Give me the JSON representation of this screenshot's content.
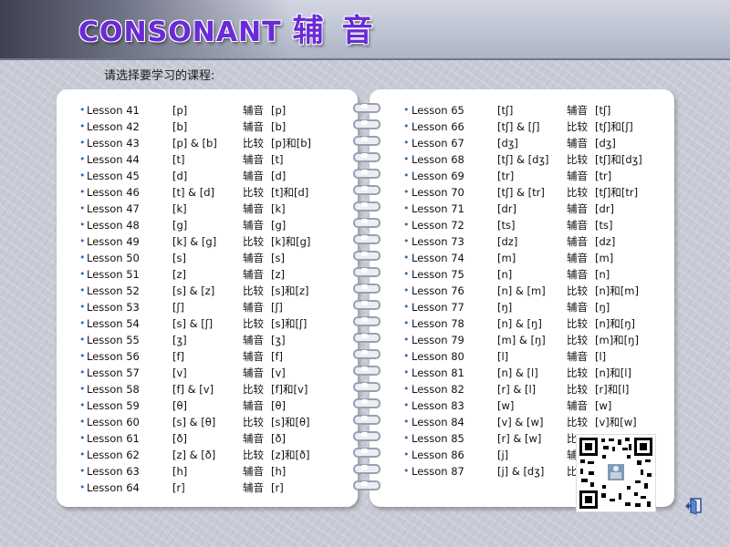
{
  "header": {
    "title_en": "CONSONANT",
    "title_cn": "辅 音"
  },
  "prompt": "请选择要学习的课程:",
  "colors": {
    "title": "#6a2ad8",
    "bullet": "#2f70b5",
    "page": "#ffffff",
    "background": "#c9ccd6"
  },
  "left_page": {
    "lessons": [
      {
        "name": "Lesson 41",
        "symbol": "[p]",
        "kind": "辅音",
        "desc": "[p]"
      },
      {
        "name": "Lesson 42",
        "symbol": "[b]",
        "kind": "辅音",
        "desc": "[b]"
      },
      {
        "name": "Lesson 43",
        "symbol": "[p] & [b]",
        "kind": "比较",
        "desc": "[p]和[b]"
      },
      {
        "name": "Lesson 44",
        "symbol": "[t]",
        "kind": "辅音",
        "desc": "[t]"
      },
      {
        "name": "Lesson 45",
        "symbol": "[d]",
        "kind": "辅音",
        "desc": "[d]"
      },
      {
        "name": "Lesson 46",
        "symbol": "[t] & [d]",
        "kind": "比较",
        "desc": "[t]和[d]"
      },
      {
        "name": "Lesson 47",
        "symbol": "[k]",
        "kind": "辅音",
        "desc": "[k]"
      },
      {
        "name": "Lesson 48",
        "symbol": "[g]",
        "kind": "辅音",
        "desc": "[g]"
      },
      {
        "name": "Lesson 49",
        "symbol": "[k] & [g]",
        "kind": "比较",
        "desc": "[k]和[g]"
      },
      {
        "name": "Lesson 50",
        "symbol": "[s]",
        "kind": "辅音",
        "desc": "[s]"
      },
      {
        "name": "Lesson 51",
        "symbol": "[z]",
        "kind": "辅音",
        "desc": "[z]"
      },
      {
        "name": "Lesson 52",
        "symbol": "[s] & [z]",
        "kind": "比较",
        "desc": "[s]和[z]"
      },
      {
        "name": "Lesson 53",
        "symbol": "[ʃ]",
        "kind": "辅音",
        "desc": "[ʃ]"
      },
      {
        "name": "Lesson 54",
        "symbol": "[s] & [ʃ]",
        "kind": "比较",
        "desc": "[s]和[ʃ]"
      },
      {
        "name": "Lesson 55",
        "symbol": "[ʒ]",
        "kind": "辅音",
        "desc": "[ʒ]"
      },
      {
        "name": "Lesson 56",
        "symbol": "[f]",
        "kind": "辅音",
        "desc": "[f]"
      },
      {
        "name": "Lesson 57",
        "symbol": "[v]",
        "kind": "辅音",
        "desc": "[v]"
      },
      {
        "name": "Lesson 58",
        "symbol": "[f] & [v]",
        "kind": "比较",
        "desc": "[f]和[v]"
      },
      {
        "name": "Lesson 59",
        "symbol": "[θ]",
        "kind": "辅音",
        "desc": "[θ]"
      },
      {
        "name": "Lesson 60",
        "symbol": "[s] & [θ]",
        "kind": "比较",
        "desc": "[s]和[θ]"
      },
      {
        "name": "Lesson 61",
        "symbol": "[ð]",
        "kind": "辅音",
        "desc": "[ð]"
      },
      {
        "name": "Lesson 62",
        "symbol": "[z] & [ð]",
        "kind": "比较",
        "desc": "[z]和[ð]"
      },
      {
        "name": "Lesson 63",
        "symbol": "[h]",
        "kind": "辅音",
        "desc": "[h]"
      },
      {
        "name": "Lesson 64",
        "symbol": "[r]",
        "kind": "辅音",
        "desc": "[r]"
      }
    ]
  },
  "right_page": {
    "lessons": [
      {
        "name": "Lesson 65",
        "symbol": "[tʃ]",
        "kind": "辅音",
        "desc": "[tʃ]"
      },
      {
        "name": "Lesson 66",
        "symbol": "[tʃ] & [ʃ]",
        "kind": "比较",
        "desc": "[tʃ]和[ʃ]"
      },
      {
        "name": "Lesson 67",
        "symbol": "[dʒ]",
        "kind": "辅音",
        "desc": "[dʒ]"
      },
      {
        "name": "Lesson 68",
        "symbol": "[tʃ] & [dʒ]",
        "kind": "比较",
        "desc": "[tʃ]和[dʒ]"
      },
      {
        "name": "Lesson 69",
        "symbol": "[tr]",
        "kind": "辅音",
        "desc": "[tr]"
      },
      {
        "name": "Lesson 70",
        "symbol": "[tʃ] & [tr]",
        "kind": "比较",
        "desc": "[tʃ]和[tr]"
      },
      {
        "name": "Lesson 71",
        "symbol": "[dr]",
        "kind": "辅音",
        "desc": "[dr]"
      },
      {
        "name": "Lesson 72",
        "symbol": "[ts]",
        "kind": "辅音",
        "desc": "[ts]"
      },
      {
        "name": "Lesson 73",
        "symbol": "[dz]",
        "kind": "辅音",
        "desc": "[dz]"
      },
      {
        "name": "Lesson 74",
        "symbol": "[m]",
        "kind": "辅音",
        "desc": "[m]"
      },
      {
        "name": "Lesson 75",
        "symbol": "[n]",
        "kind": "辅音",
        "desc": "[n]"
      },
      {
        "name": "Lesson 76",
        "symbol": "[n] & [m]",
        "kind": "比较",
        "desc": "[n]和[m]"
      },
      {
        "name": "Lesson 77",
        "symbol": "[ŋ]",
        "kind": "辅音",
        "desc": "[ŋ]"
      },
      {
        "name": "Lesson 78",
        "symbol": "[n] & [ŋ]",
        "kind": "比较",
        "desc": "[n]和[ŋ]"
      },
      {
        "name": "Lesson 79",
        "symbol": "[m] & [ŋ]",
        "kind": "比较",
        "desc": "[m]和[ŋ]"
      },
      {
        "name": "Lesson 80",
        "symbol": "[l]",
        "kind": "辅音",
        "desc": "[l]"
      },
      {
        "name": "Lesson 81",
        "symbol": "[n] & [l]",
        "kind": "比较",
        "desc": "[n]和[l]"
      },
      {
        "name": "Lesson 82",
        "symbol": "[r] & [l]",
        "kind": "比较",
        "desc": "[r]和[l]"
      },
      {
        "name": "Lesson 83",
        "symbol": "[w]",
        "kind": "辅音",
        "desc": "[w]"
      },
      {
        "name": "Lesson 84",
        "symbol": "[v] & [w]",
        "kind": "比较",
        "desc": "[v]和[w]"
      },
      {
        "name": "Lesson 85",
        "symbol": "[r] & [w]",
        "kind": "比",
        "desc": ""
      },
      {
        "name": "Lesson 86",
        "symbol": "[j]",
        "kind": "辅",
        "desc": ""
      },
      {
        "name": "Lesson 87",
        "symbol": "[j] & [dʒ]",
        "kind": "比",
        "desc": ""
      }
    ]
  },
  "icons": {
    "bullet": "•",
    "qr": "qr-code-icon",
    "exit": "exit-door-icon"
  }
}
